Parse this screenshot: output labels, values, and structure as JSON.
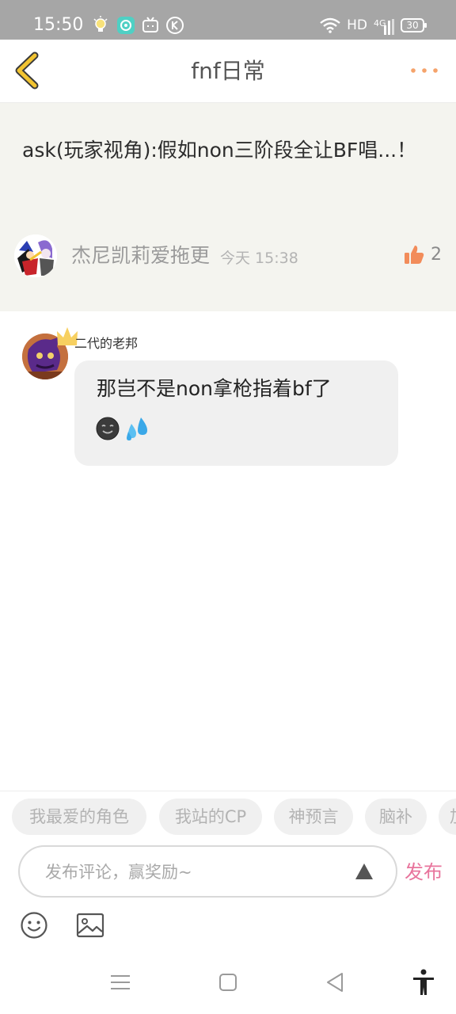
{
  "status_bar": {
    "time": "15:50",
    "network": "HD",
    "signal": "4G",
    "battery": "30",
    "notification_icons": [
      "bulb-icon",
      "app-chat-icon",
      "bilibili-icon",
      "k-icon"
    ]
  },
  "navbar": {
    "title": "fnf日常",
    "back_icon": "chevron-left-icon",
    "more_icon": "more-dots-icon"
  },
  "post": {
    "text": "ask(玩家视角):假如non三阶段全让BF唱...！",
    "author": "杰尼凯莉爱拖更",
    "time": "今天 15:38",
    "likes": "2"
  },
  "comment": {
    "author": "二代的老邦",
    "text": "那岂不是non拿枪指着bf了",
    "emojis": [
      "dark-smiling-face-icon",
      "sweat-droplets-icon"
    ]
  },
  "tags": [
    "我最爱的角色",
    "我站的CP",
    "神预言",
    "脑补",
    "加"
  ],
  "input": {
    "placeholder": "发布评论，赢奖励~",
    "publish_label": "发布"
  },
  "tools": [
    "emoji-icon",
    "image-icon"
  ],
  "system_nav": [
    "menu-icon",
    "home-icon",
    "back-icon",
    "accessibility-icon"
  ],
  "colors": {
    "accent_back": "#f2c431",
    "accent_more": "#f5a36b",
    "publish": "#e8749c",
    "post_bg": "#f4f4ef",
    "bubble_bg": "#f0f0f0"
  }
}
